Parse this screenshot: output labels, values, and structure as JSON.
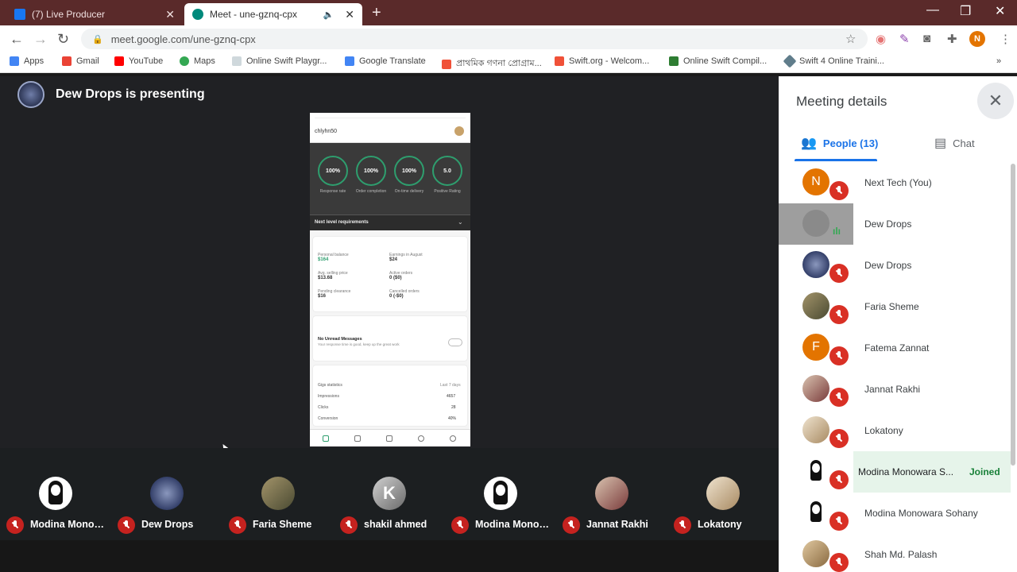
{
  "browser": {
    "tabs": [
      {
        "title": "(7) Live Producer",
        "favicon_color": "#1877f2"
      },
      {
        "title": "Meet - une-gznq-cpx",
        "favicon_color": "#00897b"
      }
    ],
    "url": "meet.google.com/une-gznq-cpx",
    "profile_initial": "N",
    "bookmarks": [
      {
        "label": "Apps",
        "color": "#4285f4"
      },
      {
        "label": "Gmail",
        "color": "#ea4335"
      },
      {
        "label": "YouTube",
        "color": "#ff0000"
      },
      {
        "label": "Maps",
        "color": "#34a853"
      },
      {
        "label": "Online Swift Playgr...",
        "color": "#cfd8dc"
      },
      {
        "label": "Google Translate",
        "color": "#4285f4"
      },
      {
        "label": "প্রাথমিক গণনা প্রোগ্রাম...",
        "color": "#f05138"
      },
      {
        "label": "Swift.org - Welcom...",
        "color": "#f05138"
      },
      {
        "label": "Online Swift Compil...",
        "color": "#2e7d32"
      },
      {
        "label": "Swift 4 Online Traini...",
        "color": "#607d8b"
      }
    ]
  },
  "stage": {
    "presenter_label": "Dew Drops is presenting",
    "phone": {
      "header": "chlyhn50",
      "circles": [
        {
          "value": "100%",
          "label": "Response rate"
        },
        {
          "value": "100%",
          "label": "Order completion"
        },
        {
          "value": "100%",
          "label": "On-time delivery"
        },
        {
          "value": "5.0",
          "label": "Positive Rating"
        }
      ],
      "section_bar": "Next level requirements",
      "earnings": [
        {
          "label": "Personal balance",
          "value": "$164"
        },
        {
          "label": "Earnings in August",
          "value": "$24"
        },
        {
          "label": "Avg. selling price",
          "value": "$13.68"
        },
        {
          "label": "Active orders",
          "value": "0 ($0)"
        },
        {
          "label": "Pending clearance",
          "value": "$16"
        },
        {
          "label": "Cancelled orders",
          "value": "0 (-$0)"
        }
      ],
      "inbox_title": "No Unread Messages",
      "inbox_sub": "Your response time is good, keep up the great work",
      "gigs": [
        {
          "label": "Gigs statistics",
          "value": "Last 7 days"
        },
        {
          "label": "Impressions",
          "value": "4657"
        },
        {
          "label": "Clicks",
          "value": "28"
        },
        {
          "label": "Conversion",
          "value": "40%"
        }
      ]
    },
    "filmstrip": [
      {
        "name": "Modina Monowara S...",
        "avatar": "woman-sketch"
      },
      {
        "name": "Dew Drops",
        "avatar": "globe"
      },
      {
        "name": "Faria Sheme",
        "avatar": "photo"
      },
      {
        "name": "shakil ahmed",
        "avatar": "logo-k"
      },
      {
        "name": "Modina Monowara S...",
        "avatar": "woman-sketch"
      },
      {
        "name": "Jannat Rakhi",
        "avatar": "photo"
      },
      {
        "name": "Lokatony",
        "avatar": "photo"
      }
    ]
  },
  "panel": {
    "title": "Meeting details",
    "tabs": {
      "people": "People (13)",
      "chat": "Chat"
    },
    "participants": [
      {
        "name": "Next Tech (You)",
        "avatar_type": "initial",
        "initial": "N",
        "color": "#e37400",
        "state": "muted"
      },
      {
        "name": "Dew Drops",
        "avatar_type": "globe",
        "color": "#5f6b8a",
        "state": "speaking"
      },
      {
        "name": "Dew Drops",
        "avatar_type": "globe",
        "color": "#3c4c7a",
        "state": "muted"
      },
      {
        "name": "Faria Sheme",
        "avatar_type": "photo",
        "color": "#7a6a4a",
        "state": "muted"
      },
      {
        "name": "Fatema Zannat",
        "avatar_type": "initial",
        "initial": "F",
        "color": "#e37400",
        "state": "muted"
      },
      {
        "name": "Jannat Rakhi",
        "avatar_type": "photo",
        "color": "#6b3b3b",
        "state": "muted"
      },
      {
        "name": "Lokatony",
        "avatar_type": "photo",
        "color": "#c9b79a",
        "state": "muted"
      },
      {
        "name": "Modina Monowara S...",
        "avatar_type": "sketch",
        "color": "#ffffff",
        "state": "muted",
        "status": "Joined"
      },
      {
        "name": "Modina Monowara Sohany",
        "avatar_type": "sketch",
        "color": "#ffffff",
        "state": "muted"
      },
      {
        "name": "Shah Md. Palash",
        "avatar_type": "photo",
        "color": "#b08a5a",
        "state": "muted"
      }
    ]
  },
  "colors": {
    "accent": "#1a73e8",
    "mute": "#d93025",
    "joined": "#188038",
    "tabbar": "#5a2a2a"
  }
}
